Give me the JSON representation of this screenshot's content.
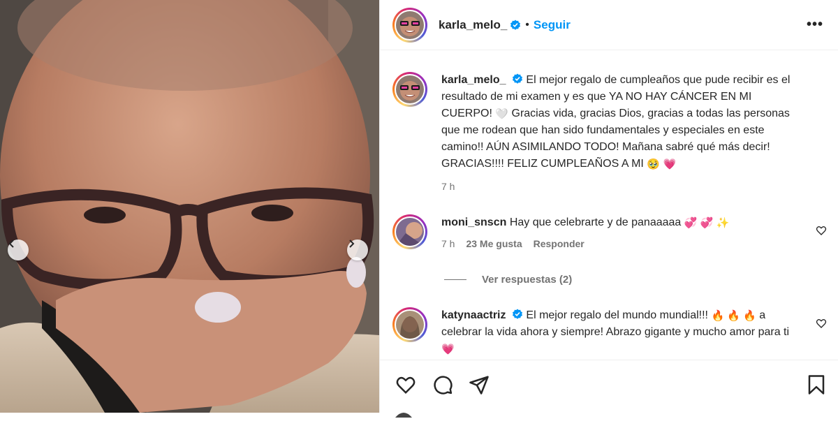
{
  "post": {
    "nav_left_icon": "chevron-left-icon",
    "nav_right_icon": "chevron-right-icon"
  },
  "header": {
    "username": "karla_melo_",
    "separator": "•",
    "follow_label": "Seguir",
    "more_label": "•••"
  },
  "caption": {
    "username": "karla_melo_",
    "text_1": "El mejor regalo de cumpleaños que pude recibir es el resultado de mi examen y es que YA NO HAY CÁNCER EN MI CUERPO!",
    "emoji_1": "🤍",
    "text_2": "Gracias vida, gracias Dios, gracias a todas las personas que me rodean que han sido fundamentales y especiales en este camino!! AÚN ASIMILANDO TODO! Mañana sabré qué más decir! GRACIAS!!!! FELIZ CUMPLEAÑOS A MI",
    "emoji_2": "🥹",
    "emoji_3": "💗",
    "time": "7 h"
  },
  "comments": [
    {
      "username": "moni_snscn",
      "text": "Hay que celebrarte y de panaaaaa",
      "emojis": "💞 💞 ✨",
      "time": "7 h",
      "likes": "23 Me gusta",
      "reply_label": "Responder"
    },
    {
      "username": "katynaactriz",
      "text_1": "El mejor regalo del mundo mundial!!!",
      "emojis": "🔥 🔥 🔥",
      "text_2": "a celebrar la vida ahora y siempre! Abrazo gigante y mucho amor para ti",
      "emoji_end": "💗"
    }
  ],
  "view_replies_label": "Ver respuestas (2)",
  "actions": {
    "like_icon": "heart-icon",
    "comment_icon": "comment-icon",
    "share_icon": "send-icon",
    "save_icon": "bookmark-icon"
  },
  "colors": {
    "accent_blue": "#0095f6",
    "verified_blue": "#0095f6",
    "text_primary": "#262626",
    "text_secondary": "#737373",
    "border": "#efefef"
  }
}
